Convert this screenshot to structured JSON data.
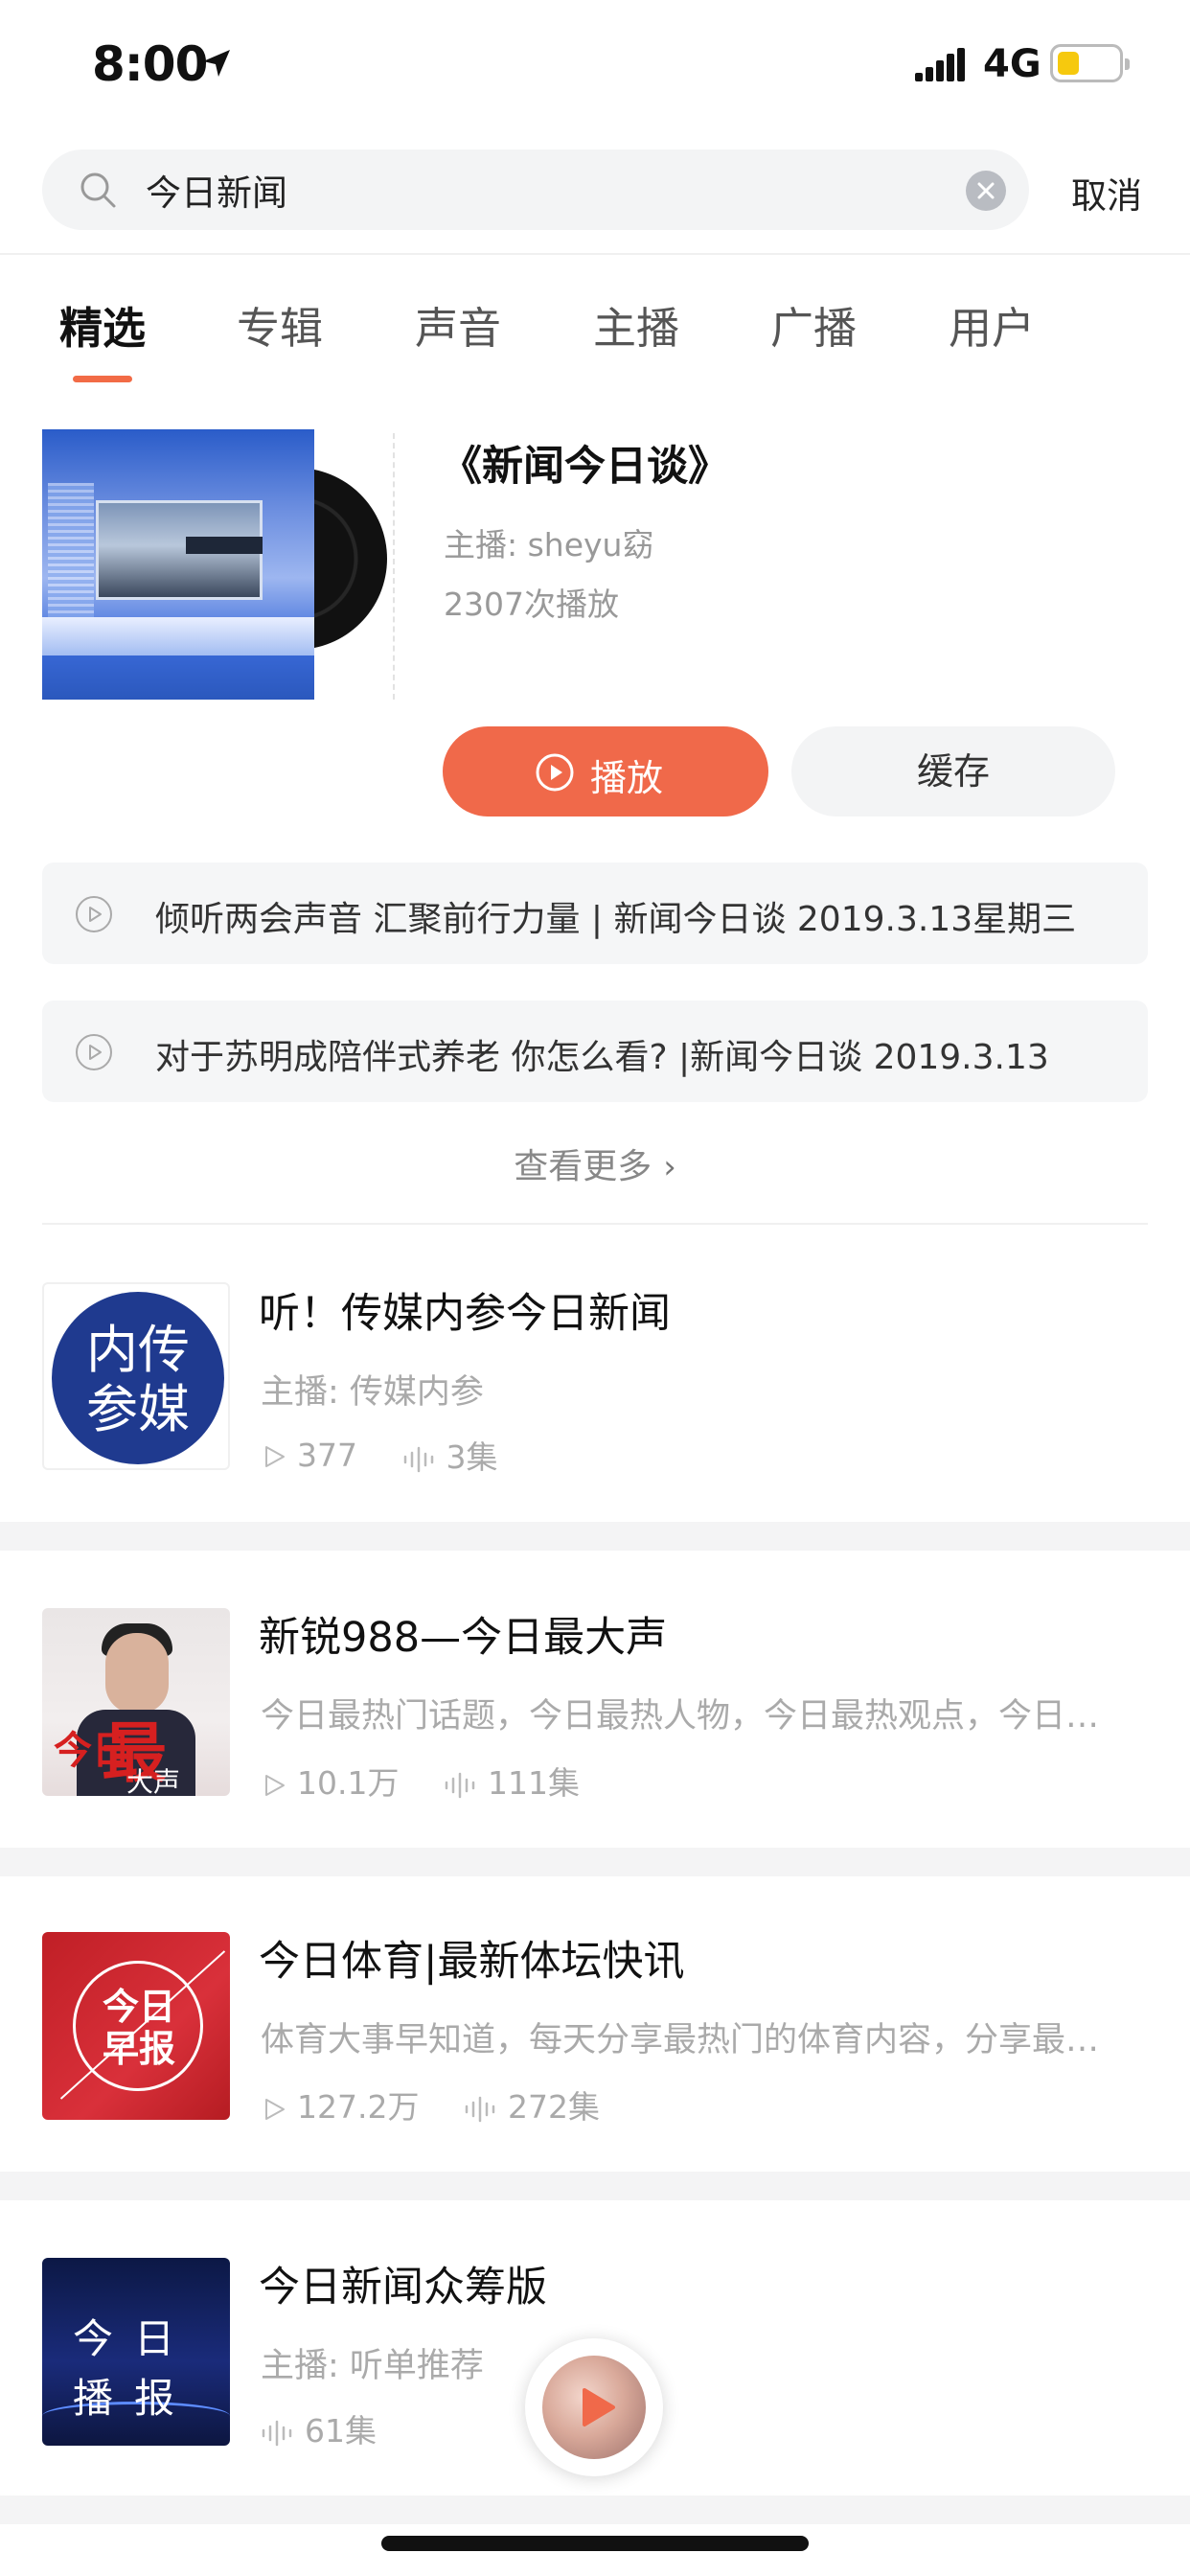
{
  "status_bar": {
    "time": "8:00",
    "network": "4G",
    "battery_level": 0.35
  },
  "search": {
    "value": "今日新闻",
    "cancel_label": "取消"
  },
  "tabs": [
    {
      "label": "精选",
      "active": true
    },
    {
      "label": "专辑",
      "active": false
    },
    {
      "label": "声音",
      "active": false
    },
    {
      "label": "主播",
      "active": false
    },
    {
      "label": "广播",
      "active": false
    },
    {
      "label": "用户",
      "active": false
    }
  ],
  "top_result": {
    "title": "《新闻今日谈》",
    "host": "主播: sheyu窈",
    "plays": "2307次播放",
    "play_label": "播放",
    "cache_label": "缓存",
    "tracks": [
      "倾听两会声音 汇聚前行力量 | 新闻今日谈 2019.3.13星期三",
      "对于苏明成陪伴式养老 你怎么看? |新闻今日谈 2019.3.13"
    ],
    "more_label": "查看更多"
  },
  "results": [
    {
      "title": "听！传媒内参今日新闻",
      "subtitle": "主播: 传媒内参",
      "plays": "377",
      "episodes": "3集",
      "cover_text": "内传参媒"
    },
    {
      "title": "新锐988—今日最大声",
      "subtitle": "今日最热门话题，今日最热人物，今日最热观点，今日最大声",
      "plays": "10.1万",
      "episodes": "111集",
      "cover_text_small": "今日",
      "cover_text_big": "最",
      "cover_text_sub": "大声"
    },
    {
      "title": "今日体育|最新体坛快讯",
      "subtitle": "体育大事早知道，每天分享最热门的体育内容，分享最新体坛快讯",
      "plays": "127.2万",
      "episodes": "272集",
      "cover_text": "今日早报"
    },
    {
      "title": "今日新闻众筹版",
      "subtitle": "主播: 听单推荐",
      "episodes": "61集",
      "cover_text": "今日播报"
    }
  ],
  "colors": {
    "accent": "#f26b46",
    "play_button": "#f0694a",
    "muted_text": "#aaaaaa"
  }
}
